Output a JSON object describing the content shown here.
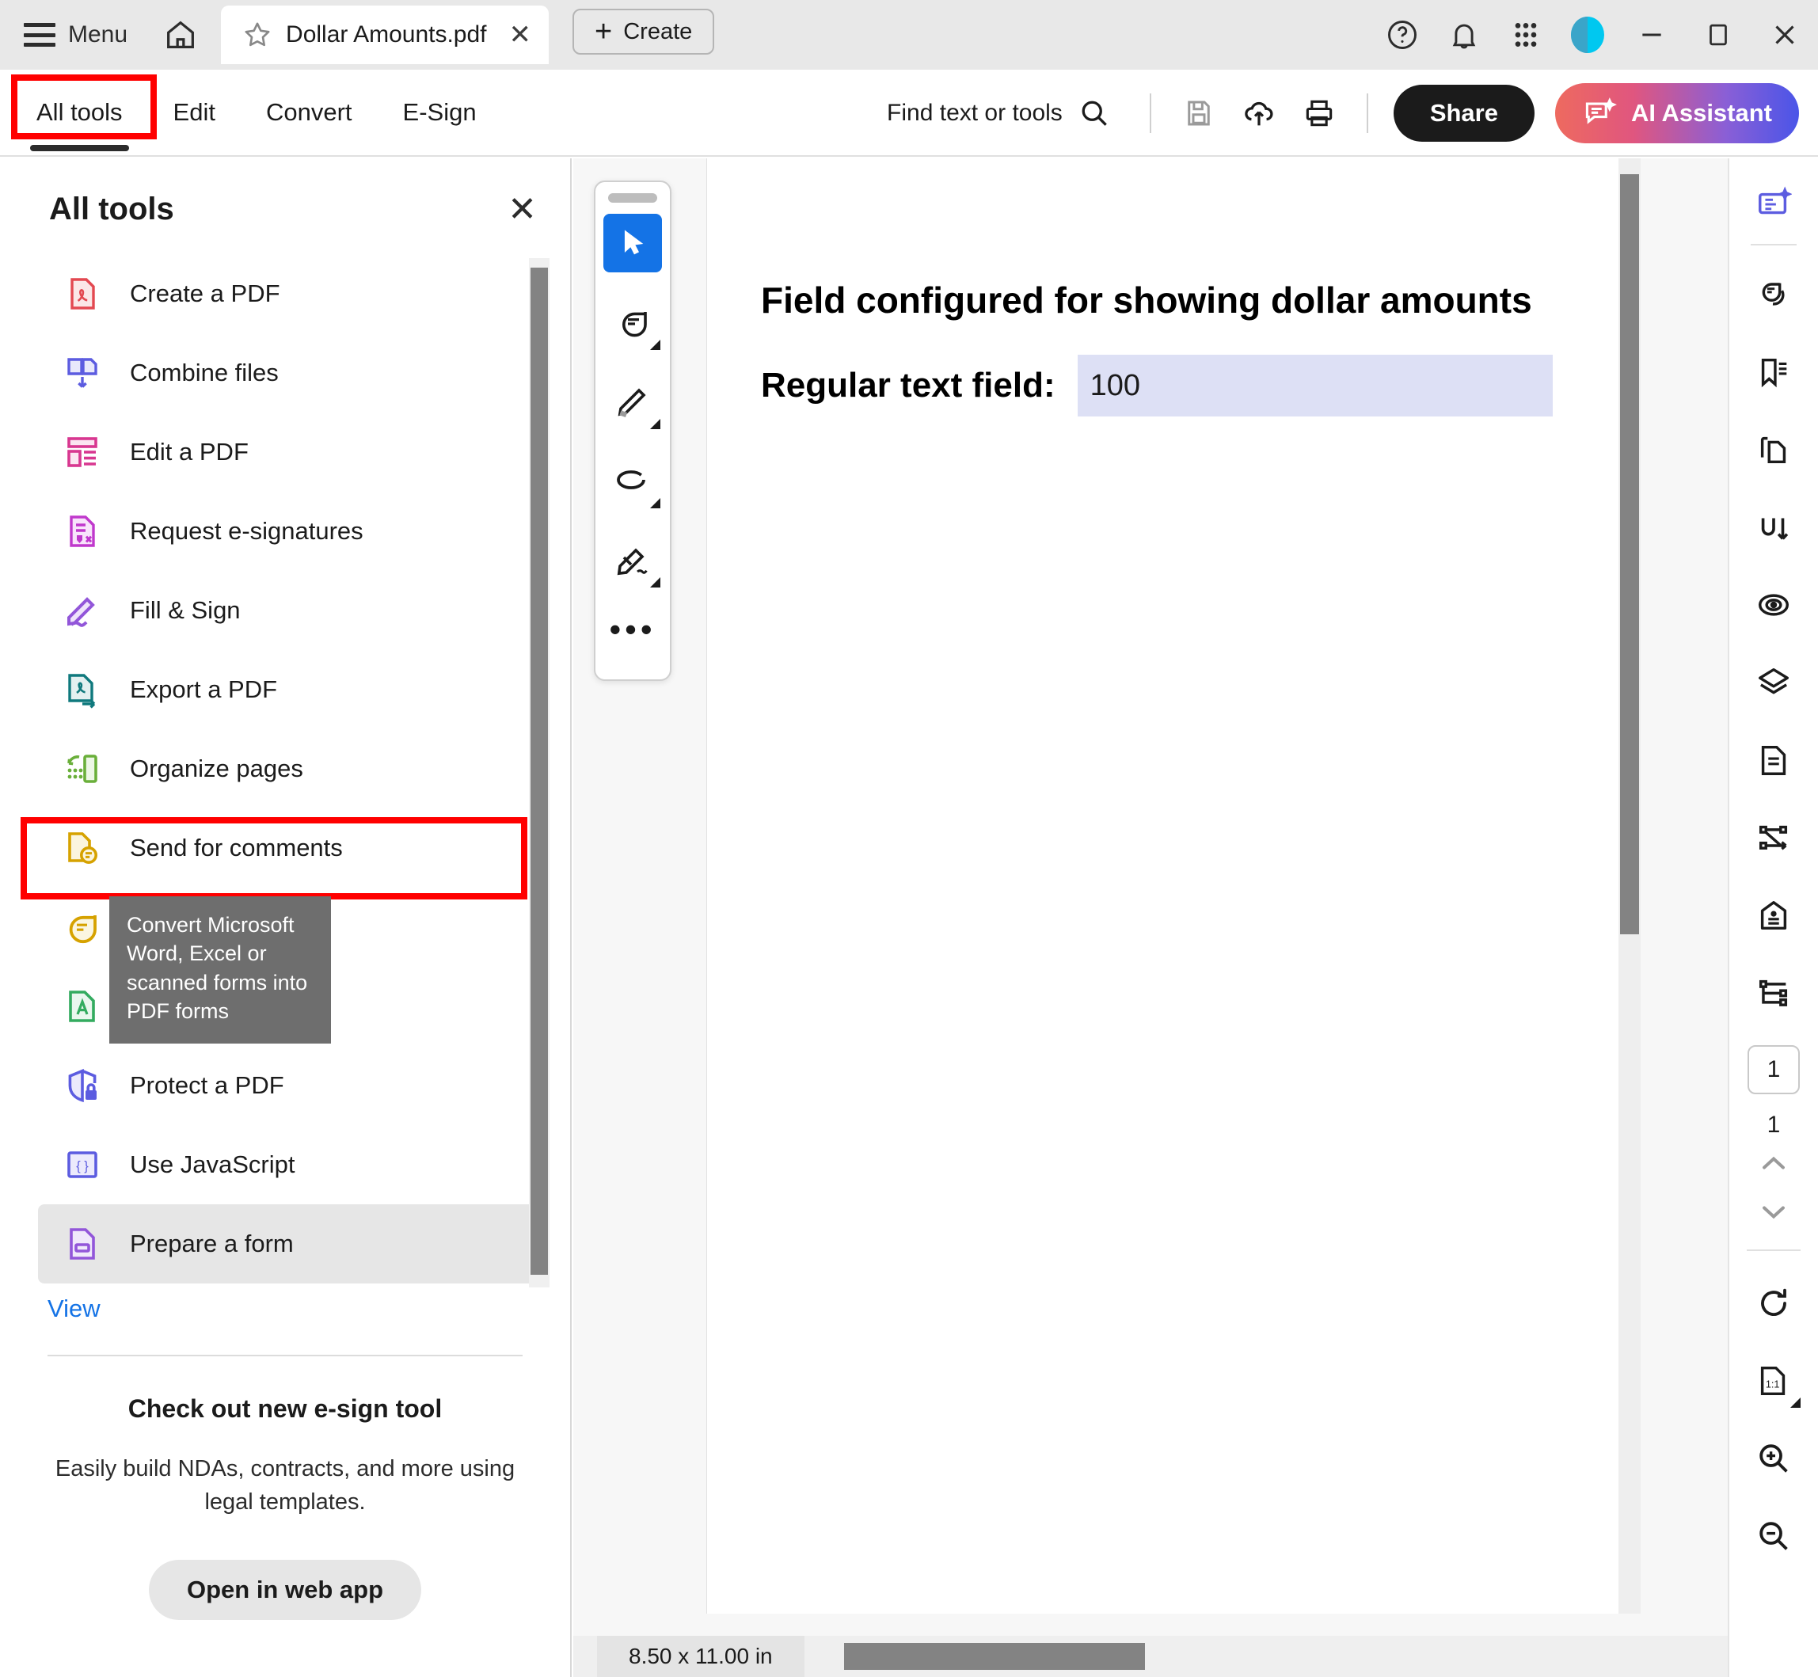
{
  "titlebar": {
    "menu_label": "Menu",
    "home_icon": "home-icon",
    "tab_title": "Dollar Amounts.pdf",
    "tab_star_icon": "star-icon",
    "tab_close_icon": "close-icon",
    "create_label": "Create",
    "help_icon": "help-icon",
    "bell_icon": "notifications-icon",
    "apps_icon": "app-grid-icon",
    "avatar_icon": "user-avatar",
    "minimize_icon": "minimize-icon",
    "maximize_icon": "maximize-icon",
    "close_icon": "window-close-icon"
  },
  "toolbar": {
    "tabs": [
      {
        "label": "All tools",
        "active": true
      },
      {
        "label": "Edit",
        "active": false
      },
      {
        "label": "Convert",
        "active": false
      },
      {
        "label": "E-Sign",
        "active": false
      }
    ],
    "find_label": "Find text or tools",
    "search_icon": "search-icon",
    "save_icon": "save-icon",
    "cloud_upload_icon": "cloud-upload-icon",
    "print_icon": "print-icon",
    "share_label": "Share",
    "ai_label": "AI Assistant",
    "ai_icon": "ai-sparkle-icon"
  },
  "left_panel": {
    "title": "All tools",
    "close_icon": "close-icon",
    "tools": [
      {
        "label": "Create a PDF",
        "icon": "pdf-create-icon",
        "color": "#e34850",
        "selected": false
      },
      {
        "label": "Combine files",
        "icon": "combine-files-icon",
        "color": "#5c5ce0",
        "selected": false
      },
      {
        "label": "Edit a PDF",
        "icon": "edit-pdf-icon",
        "color": "#d83790",
        "selected": false
      },
      {
        "label": "Request e-signatures",
        "icon": "request-esign-icon",
        "color": "#c038cc",
        "selected": false
      },
      {
        "label": "Fill & Sign",
        "icon": "fill-sign-icon",
        "color": "#9256d9",
        "selected": false
      },
      {
        "label": "Export a PDF",
        "icon": "export-pdf-icon",
        "color": "#0f797d",
        "selected": false
      },
      {
        "label": "Organize pages",
        "icon": "organize-pages-icon",
        "color": "#6aaf3a",
        "selected": false
      },
      {
        "label": "Send for comments",
        "icon": "send-comments-icon",
        "color": "#d6a200",
        "selected": false
      },
      {
        "label": "Add comments",
        "icon": "add-comments-icon",
        "color": "#d6a200",
        "selected": false
      },
      {
        "label": "Scan & OCR",
        "icon": "scan-ocr-icon",
        "color": "#33ab5f",
        "selected": false
      },
      {
        "label": "Protect a PDF",
        "icon": "protect-pdf-icon",
        "color": "#5c5ce0",
        "selected": false
      },
      {
        "label": "Use JavaScript",
        "icon": "javascript-icon",
        "color": "#5c5ce0",
        "selected": false
      },
      {
        "label": "Prepare a form",
        "icon": "prepare-form-icon",
        "color": "#9256d9",
        "selected": true
      }
    ],
    "view_more_label": "View",
    "tooltip_text": "Convert Microsoft Word, Excel or scanned forms into PDF forms",
    "promo_title": "Check out new e-sign tool",
    "promo_body": "Easily build NDAs, contracts, and more using legal templates.",
    "promo_button": "Open in web app"
  },
  "vertical_toolbar": {
    "buttons": [
      {
        "icon": "select-cursor-icon",
        "active": true,
        "has_caret": false
      },
      {
        "icon": "comment-icon",
        "active": false,
        "has_caret": true
      },
      {
        "icon": "highlight-icon",
        "active": false,
        "has_caret": true
      },
      {
        "icon": "draw-oval-icon",
        "active": false,
        "has_caret": true
      },
      {
        "icon": "signature-pen-icon",
        "active": false,
        "has_caret": true
      }
    ],
    "more_label": "•••"
  },
  "document": {
    "heading": "Field configured for showing dollar amounts",
    "field_label": "Regular text field:",
    "field_value": "100",
    "field_bg": "#dde0f5"
  },
  "statusbar": {
    "page_size": "8.50 x 11.00 in"
  },
  "right_rail": {
    "buttons": [
      {
        "icon": "ai-assistant-panel-icon",
        "accent": "#5c5ce0"
      },
      {
        "icon": "comments-panel-icon",
        "accent": "#1b1b1b"
      },
      {
        "icon": "bookmarks-icon",
        "accent": "#1b1b1b"
      },
      {
        "icon": "page-thumbnails-icon",
        "accent": "#1b1b1b"
      },
      {
        "icon": "attachments-icon",
        "accent": "#1b1b1b"
      },
      {
        "icon": "accessibility-icon",
        "accent": "#1b1b1b"
      },
      {
        "icon": "layers-icon",
        "accent": "#1b1b1b"
      },
      {
        "icon": "content-icon",
        "accent": "#1b1b1b"
      },
      {
        "icon": "order-icon",
        "accent": "#1b1b1b"
      },
      {
        "icon": "tags-icon",
        "accent": "#1b1b1b"
      },
      {
        "icon": "structure-tree-icon",
        "accent": "#1b1b1b"
      }
    ],
    "current_page": "1",
    "total_pages": "1",
    "prev_page_icon": "chevron-up-icon",
    "next_page_icon": "chevron-down-icon",
    "rotate_icon": "rotate-clockwise-icon",
    "fit_icon": "actual-size-icon",
    "zoom_in_icon": "zoom-in-icon",
    "zoom_out_icon": "zoom-out-icon"
  },
  "highlights": {
    "all_tools_box": "red-highlight-box",
    "prepare_form_box": "red-highlight-box",
    "color": "#ff0000"
  }
}
